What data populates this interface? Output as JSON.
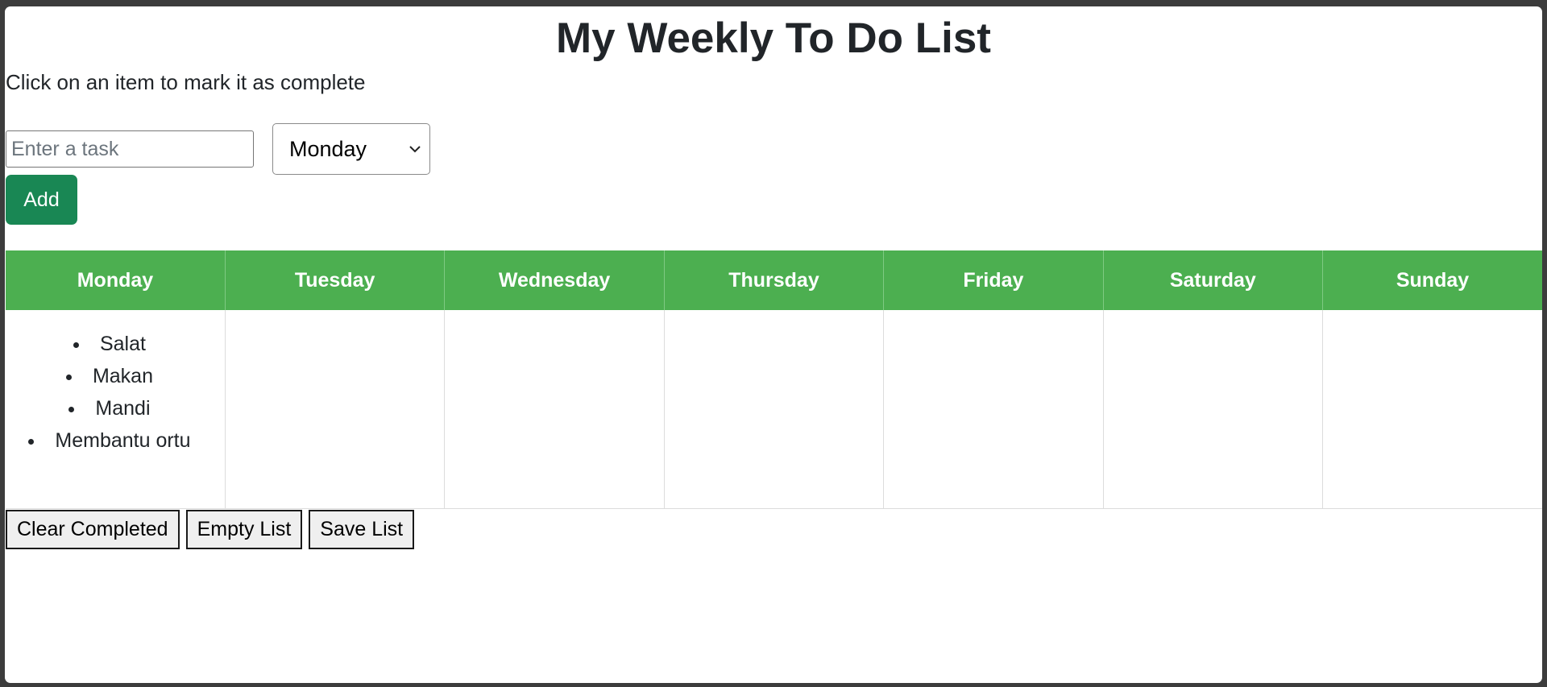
{
  "header": {
    "title": "My Weekly To Do List",
    "subtitle": "Click on an item to mark it as complete"
  },
  "form": {
    "task_placeholder": "Enter a task",
    "task_value": "",
    "day_selected": "Monday",
    "add_label": "Add"
  },
  "week": {
    "days": [
      "Monday",
      "Tuesday",
      "Wednesday",
      "Thursday",
      "Friday",
      "Saturday",
      "Sunday"
    ],
    "tasks": {
      "Monday": [
        "Salat",
        "Makan",
        "Mandi",
        "Membantu ortu"
      ],
      "Tuesday": [],
      "Wednesday": [],
      "Thursday": [],
      "Friday": [],
      "Saturday": [],
      "Sunday": []
    }
  },
  "actions": {
    "clear_completed_label": "Clear Completed",
    "empty_list_label": "Empty List",
    "save_list_label": "Save List"
  },
  "colors": {
    "header_green": "#4caf50",
    "add_button_green": "#198754"
  },
  "icons": {
    "select_arrow": "chevron-down-icon"
  }
}
